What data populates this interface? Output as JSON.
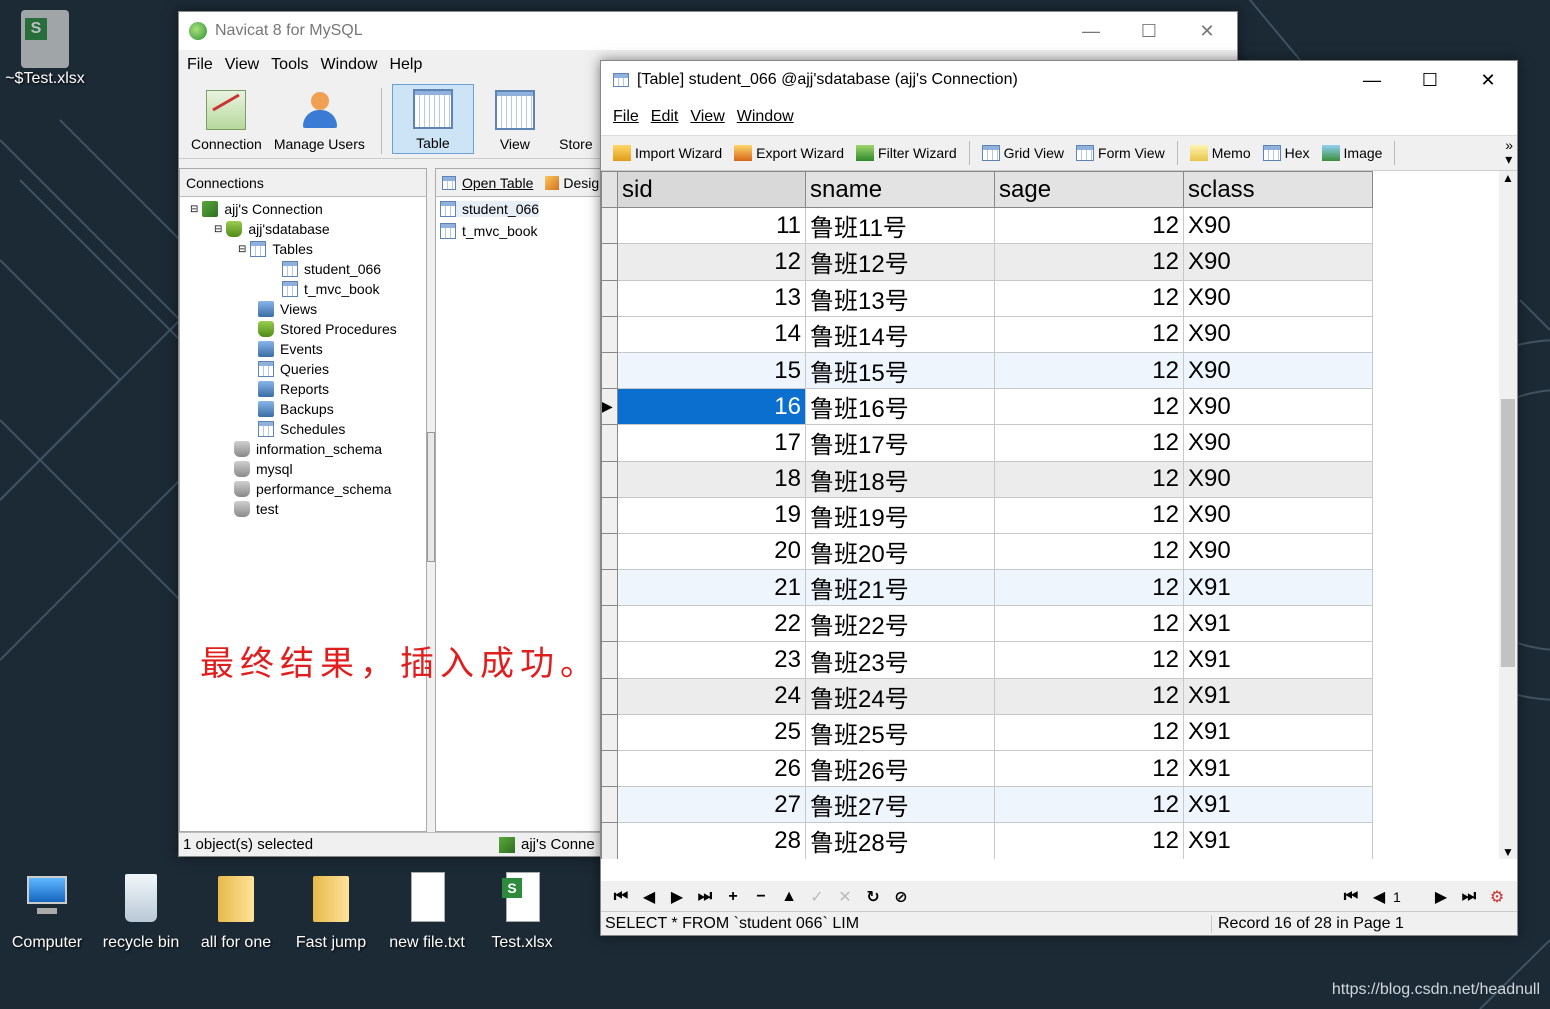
{
  "desktop": {
    "top_icon": {
      "label": "~$Test.xlsx"
    },
    "icons": [
      {
        "label": "Computer"
      },
      {
        "label": "recycle bin"
      },
      {
        "label": "all for one"
      },
      {
        "label": "Fast jump"
      },
      {
        "label": "new file.txt"
      },
      {
        "label": "Test.xlsx"
      }
    ],
    "watermark": "https://blog.csdn.net/headnull"
  },
  "navicat": {
    "title": "Navicat 8 for MySQL",
    "menu": [
      "File",
      "View",
      "Tools",
      "Window",
      "Help"
    ],
    "toolbar": [
      "Connection",
      "Manage Users",
      "Table",
      "View",
      "Store"
    ],
    "connections_header": "Connections",
    "tree": {
      "connection": "ajj's Connection",
      "database": "ajj'sdatabase",
      "tables": "Tables",
      "table1": "student_066",
      "table2": "t_mvc_book",
      "views": "Views",
      "procedures": "Stored Procedures",
      "events": "Events",
      "queries": "Queries",
      "reports": "Reports",
      "backups": "Backups",
      "schedules": "Schedules",
      "db2": "information_schema",
      "db3": "mysql",
      "db4": "performance_schema",
      "db5": "test"
    },
    "object_toolbar": {
      "open": "Open Table",
      "design": "Desig"
    },
    "objects": [
      "student_066",
      "t_mvc_book"
    ],
    "status_left": "1 object(s) selected",
    "status_right": "ajj's Conne",
    "annotation": "最终结果，插入成功。"
  },
  "table_window": {
    "title": "[Table] student_066 @ajj'sdatabase (ajj's Connection)",
    "menu": [
      "File",
      "Edit",
      "View",
      "Window"
    ],
    "toolbar": [
      "Import Wizard",
      "Export Wizard",
      "Filter Wizard",
      "Grid View",
      "Form View",
      "Memo",
      "Hex",
      "Image"
    ],
    "columns": [
      "sid",
      "sname",
      "sage",
      "sclass"
    ],
    "rows": [
      [
        "11",
        "鲁班11号",
        "12",
        "X90"
      ],
      [
        "12",
        "鲁班12号",
        "12",
        "X90"
      ],
      [
        "13",
        "鲁班13号",
        "12",
        "X90"
      ],
      [
        "14",
        "鲁班14号",
        "12",
        "X90"
      ],
      [
        "15",
        "鲁班15号",
        "12",
        "X90"
      ],
      [
        "16",
        "鲁班16号",
        "12",
        "X90"
      ],
      [
        "17",
        "鲁班17号",
        "12",
        "X90"
      ],
      [
        "18",
        "鲁班18号",
        "12",
        "X90"
      ],
      [
        "19",
        "鲁班19号",
        "12",
        "X90"
      ],
      [
        "20",
        "鲁班20号",
        "12",
        "X90"
      ],
      [
        "21",
        "鲁班21号",
        "12",
        "X91"
      ],
      [
        "22",
        "鲁班22号",
        "12",
        "X91"
      ],
      [
        "23",
        "鲁班23号",
        "12",
        "X91"
      ],
      [
        "24",
        "鲁班24号",
        "12",
        "X91"
      ],
      [
        "25",
        "鲁班25号",
        "12",
        "X91"
      ],
      [
        "26",
        "鲁班26号",
        "12",
        "X91"
      ],
      [
        "27",
        "鲁班27号",
        "12",
        "X91"
      ],
      [
        "28",
        "鲁班28号",
        "12",
        "X91"
      ]
    ],
    "selected_row": 5,
    "page": "1",
    "sql": "SELECT * FROM `student 066` LIM",
    "record_status": "Record 16 of 28 in Page 1"
  }
}
